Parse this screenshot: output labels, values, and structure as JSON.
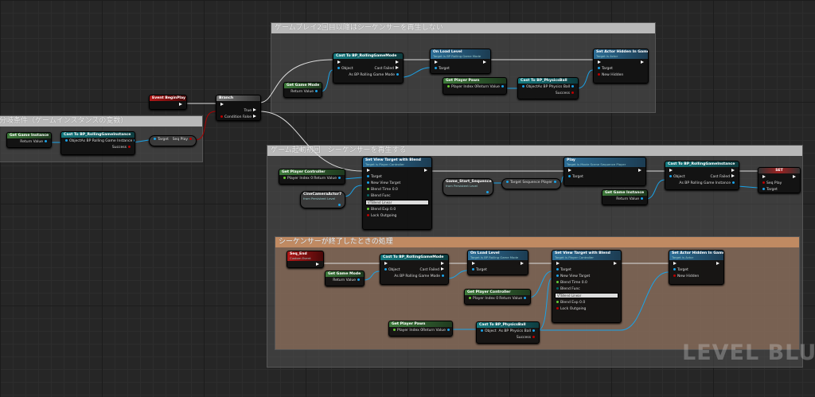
{
  "comments": [
    {
      "title": "ゲームプレイ2回目以降はシーケンサーを再生しない"
    },
    {
      "title": "分岐条件（ゲームインスタンスの変数）"
    },
    {
      "title": "ゲーム起動初回　シーケンサーを再生する"
    },
    {
      "title": "シーケンサーが終了したときの処理"
    }
  ],
  "watermark": "LEVEL BLUEPRINT",
  "nodes": [
    {
      "kind": "event",
      "title": "Event BeginPlay",
      "exec_out": true,
      "rows": []
    },
    {
      "kind": "branch",
      "title": "Branch",
      "exec_in": true,
      "rows": [
        [
          "",
          "True"
        ],
        [
          "Condition",
          "False"
        ]
      ]
    },
    {
      "kind": "pure",
      "title": "Get Game Instance",
      "rows": [
        [
          "",
          "Return Value"
        ]
      ]
    },
    {
      "kind": "cast",
      "title": "Cast To BP_RollingGameInstance",
      "rows": [
        [
          "Object",
          "As BP Rolling Game Instance"
        ],
        [
          "",
          "Success"
        ]
      ]
    },
    {
      "kind": "var",
      "rows": [
        [
          "Target",
          "Seq Play"
        ]
      ]
    },
    {
      "kind": "cast",
      "title": "Cast To BP_RollingGameMode",
      "exec_in": true,
      "exec_out": true,
      "rows": [
        [
          "Object",
          "Cast Failed"
        ],
        [
          "",
          "As BP Rolling Game Mode"
        ]
      ]
    },
    {
      "kind": "func",
      "title": "On Load Level",
      "subtitle": "Target is BP Rolling Game Mode",
      "exec_in": true,
      "exec_out": true,
      "rows": [
        [
          "Target",
          ""
        ]
      ]
    },
    {
      "kind": "func",
      "title": "Set Actor Hidden In Game",
      "subtitle": "Target is Actor",
      "exec_in": true,
      "exec_out": true,
      "rows": [
        [
          "Target",
          ""
        ],
        [
          "New Hidden",
          ""
        ]
      ]
    },
    {
      "kind": "pure",
      "title": "Get Game Mode",
      "rows": [
        [
          "",
          "Return Value"
        ]
      ]
    },
    {
      "kind": "pure",
      "title": "Get Player Pawn",
      "rows": [
        [
          "Player Index 0",
          "Return Value"
        ]
      ]
    },
    {
      "kind": "cast",
      "title": "Cast To BP_PhysicsBall",
      "rows": [
        [
          "Object",
          "As BP Physics Ball"
        ],
        [
          "",
          "Success"
        ]
      ]
    },
    {
      "kind": "pure",
      "title": "Get Player Controller",
      "rows": [
        [
          "Player Index 0",
          "Return Value"
        ]
      ]
    },
    {
      "kind": "var",
      "title": "CineCameraActor7",
      "subtitle": "from Persistent Level",
      "rows": []
    },
    {
      "kind": "func",
      "title": "Set View Target with Blend",
      "subtitle": "Target is Player Controller",
      "exec_in": true,
      "exec_out": true,
      "rows": [
        [
          "Target",
          ""
        ],
        [
          "New View Target",
          ""
        ],
        [
          "Blend Time 0.0",
          ""
        ],
        [
          "Blend Func",
          ""
        ],
        [
          "Blend Exp 0.0",
          ""
        ],
        [
          "Lock Outgoing",
          ""
        ]
      ],
      "combo": "VTBlend Linear"
    },
    {
      "kind": "var",
      "title": "Game_Start_Sequence",
      "subtitle": "from Persistent Level",
      "rows": []
    },
    {
      "kind": "var",
      "rows": [
        [
          "Target",
          "Sequence Player"
        ]
      ]
    },
    {
      "kind": "func",
      "title": "Play",
      "subtitle": "Target is Movie Scene Sequence Player",
      "exec_in": true,
      "exec_out": true,
      "rows": [
        [
          "Target",
          ""
        ]
      ]
    },
    {
      "kind": "pure",
      "title": "Get Game Instance",
      "rows": [
        [
          "",
          "Return Value"
        ]
      ]
    },
    {
      "kind": "cast",
      "title": "Cast To BP_RollingGameInstance",
      "exec_in": true,
      "exec_out": true,
      "rows": [
        [
          "Object",
          "Cast Failed"
        ],
        [
          "",
          "As BP Rolling Game Instance"
        ]
      ]
    },
    {
      "kind": "set",
      "title": "SET",
      "exec_in": true,
      "exec_out": true,
      "rows": [
        [
          "Seq Play",
          ""
        ],
        [
          "Target",
          ""
        ]
      ]
    },
    {
      "kind": "event",
      "title": "Seq_End",
      "subtitle": "Custom Event",
      "exec_out": true,
      "rows": []
    },
    {
      "kind": "pure",
      "title": "Get Game Mode",
      "rows": [
        [
          "",
          "Return Value"
        ]
      ]
    },
    {
      "kind": "cast",
      "title": "Cast To BP_RollingGameMode",
      "exec_in": true,
      "exec_out": true,
      "rows": [
        [
          "Object",
          "Cast Failed"
        ],
        [
          "",
          "As BP Rolling Game Mode"
        ]
      ]
    },
    {
      "kind": "func",
      "title": "On Load Level",
      "subtitle": "Target is BP Rolling Game Mode",
      "exec_in": true,
      "exec_out": true,
      "rows": [
        [
          "Target",
          ""
        ]
      ]
    },
    {
      "kind": "func",
      "title": "Set View Target with Blend",
      "subtitle": "Target is Player Controller",
      "exec_in": true,
      "exec_out": true,
      "rows": [
        [
          "Target",
          ""
        ],
        [
          "New View Target",
          ""
        ],
        [
          "Blend Time 0.0",
          ""
        ],
        [
          "Blend Func",
          ""
        ],
        [
          "Blend Exp 0.0",
          ""
        ],
        [
          "Lock Outgoing",
          ""
        ]
      ],
      "combo": "VTBlend Linear"
    },
    {
      "kind": "pure",
      "title": "Get Player Controller",
      "rows": [
        [
          "Player Index 0",
          "Return Value"
        ]
      ]
    },
    {
      "kind": "func",
      "title": "Set Actor Hidden In Game",
      "subtitle": "Target is Actor",
      "exec_in": true,
      "exec_out": true,
      "rows": [
        [
          "Target",
          ""
        ],
        [
          "New Hidden",
          ""
        ]
      ]
    },
    {
      "kind": "pure",
      "title": "Get Player Pawn",
      "rows": [
        [
          "Player Index 0",
          "Return Value"
        ]
      ]
    },
    {
      "kind": "cast",
      "title": "Cast To BP_PhysicsBall",
      "rows": [
        [
          "Object",
          "As BP Physics Ball"
        ],
        [
          "",
          "Success"
        ]
      ]
    }
  ]
}
